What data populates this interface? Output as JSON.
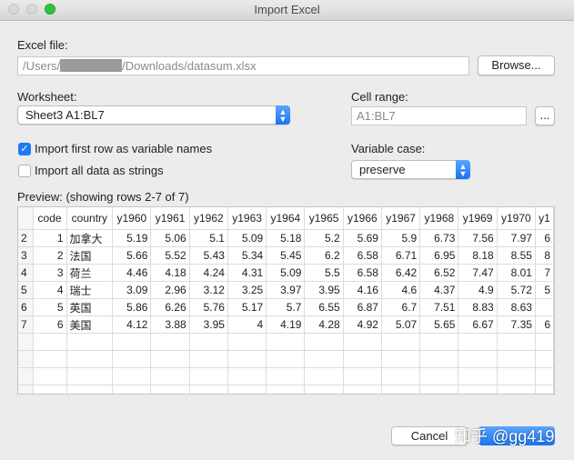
{
  "window": {
    "title": "Import Excel"
  },
  "excel_file": {
    "label": "Excel file:",
    "path_prefix": "/Users/",
    "path_suffix": "/Downloads/datasum.xlsx",
    "browse_label": "Browse..."
  },
  "worksheet": {
    "label": "Worksheet:",
    "value": "Sheet3 A1:BL7"
  },
  "cell_range": {
    "label": "Cell range:",
    "value": "A1:BL7",
    "button_label": "..."
  },
  "options": {
    "first_row_label": "Import first row as variable names",
    "first_row_checked": true,
    "strings_label": "Import all data as strings",
    "strings_checked": false
  },
  "variable_case": {
    "label": "Variable case:",
    "value": "preserve"
  },
  "preview": {
    "label": "Preview: (showing rows 2-7 of 7)",
    "columns": [
      "",
      "code",
      "country",
      "y1960",
      "y1961",
      "y1962",
      "y1963",
      "y1964",
      "y1965",
      "y1966",
      "y1967",
      "y1968",
      "y1969",
      "y1970",
      "y1"
    ],
    "rows": [
      [
        "2",
        "1",
        "加拿大",
        "5.19",
        "5.06",
        "5.1",
        "5.09",
        "5.18",
        "5.2",
        "5.69",
        "5.9",
        "6.73",
        "7.56",
        "7.97",
        "6"
      ],
      [
        "3",
        "2",
        "法国",
        "5.66",
        "5.52",
        "5.43",
        "5.34",
        "5.45",
        "6.2",
        "6.58",
        "6.71",
        "6.95",
        "8.18",
        "8.55",
        "8"
      ],
      [
        "4",
        "3",
        "荷兰",
        "4.46",
        "4.18",
        "4.24",
        "4.31",
        "5.09",
        "5.5",
        "6.58",
        "6.42",
        "6.52",
        "7.47",
        "8.01",
        "7"
      ],
      [
        "5",
        "4",
        "瑞士",
        "3.09",
        "2.96",
        "3.12",
        "3.25",
        "3.97",
        "3.95",
        "4.16",
        "4.6",
        "4.37",
        "4.9",
        "5.72",
        "5"
      ],
      [
        "6",
        "5",
        "英国",
        "5.86",
        "6.26",
        "5.76",
        "5.17",
        "5.7",
        "6.55",
        "6.87",
        "6.7",
        "7.51",
        "8.83",
        "8.63",
        ""
      ],
      [
        "7",
        "6",
        "美国",
        "4.12",
        "3.88",
        "3.95",
        "4",
        "4.19",
        "4.28",
        "4.92",
        "5.07",
        "5.65",
        "6.67",
        "7.35",
        "6"
      ]
    ]
  },
  "footer": {
    "cancel_label": "Cancel",
    "watermark": "知乎 @gg419"
  },
  "colors": {
    "accent": "#1d7cf2",
    "zoom": "#2fc540"
  }
}
